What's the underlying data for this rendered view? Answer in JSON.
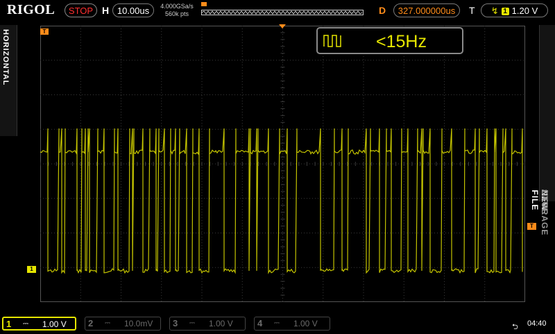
{
  "brand": "RIGOL",
  "run_state": "STOP",
  "horizontal": {
    "label": "H",
    "timebase": "10.00us"
  },
  "acquisition": {
    "sample_rate": "4.000GSa/s",
    "memory_depth": "560k pts"
  },
  "delay": {
    "label": "D",
    "value": "327.000000us"
  },
  "trigger": {
    "label": "T",
    "source": "1",
    "level": "1.20 V"
  },
  "left_tab": "HORIZONTAL",
  "right_menu": [
    "STORAGE",
    "/",
    "SAVE",
    "/",
    "NEW FILE"
  ],
  "counter": {
    "value": "<15Hz"
  },
  "markers": {
    "trigger_time": "T",
    "channel1": "1",
    "trigger_level": "T"
  },
  "channels": [
    {
      "num": "1",
      "scale": "1.00 V",
      "active": true
    },
    {
      "num": "2",
      "scale": "10.0mV",
      "active": false
    },
    {
      "num": "3",
      "scale": "1.00 V",
      "active": false
    },
    {
      "num": "4",
      "scale": "1.00 V",
      "active": false
    }
  ],
  "status": {
    "clock": "04:40"
  },
  "colors": {
    "ch1": "#e6e600",
    "trigger": "#ff8c1a",
    "stop": "#ff3030",
    "grid": "#3a3a3a"
  }
}
